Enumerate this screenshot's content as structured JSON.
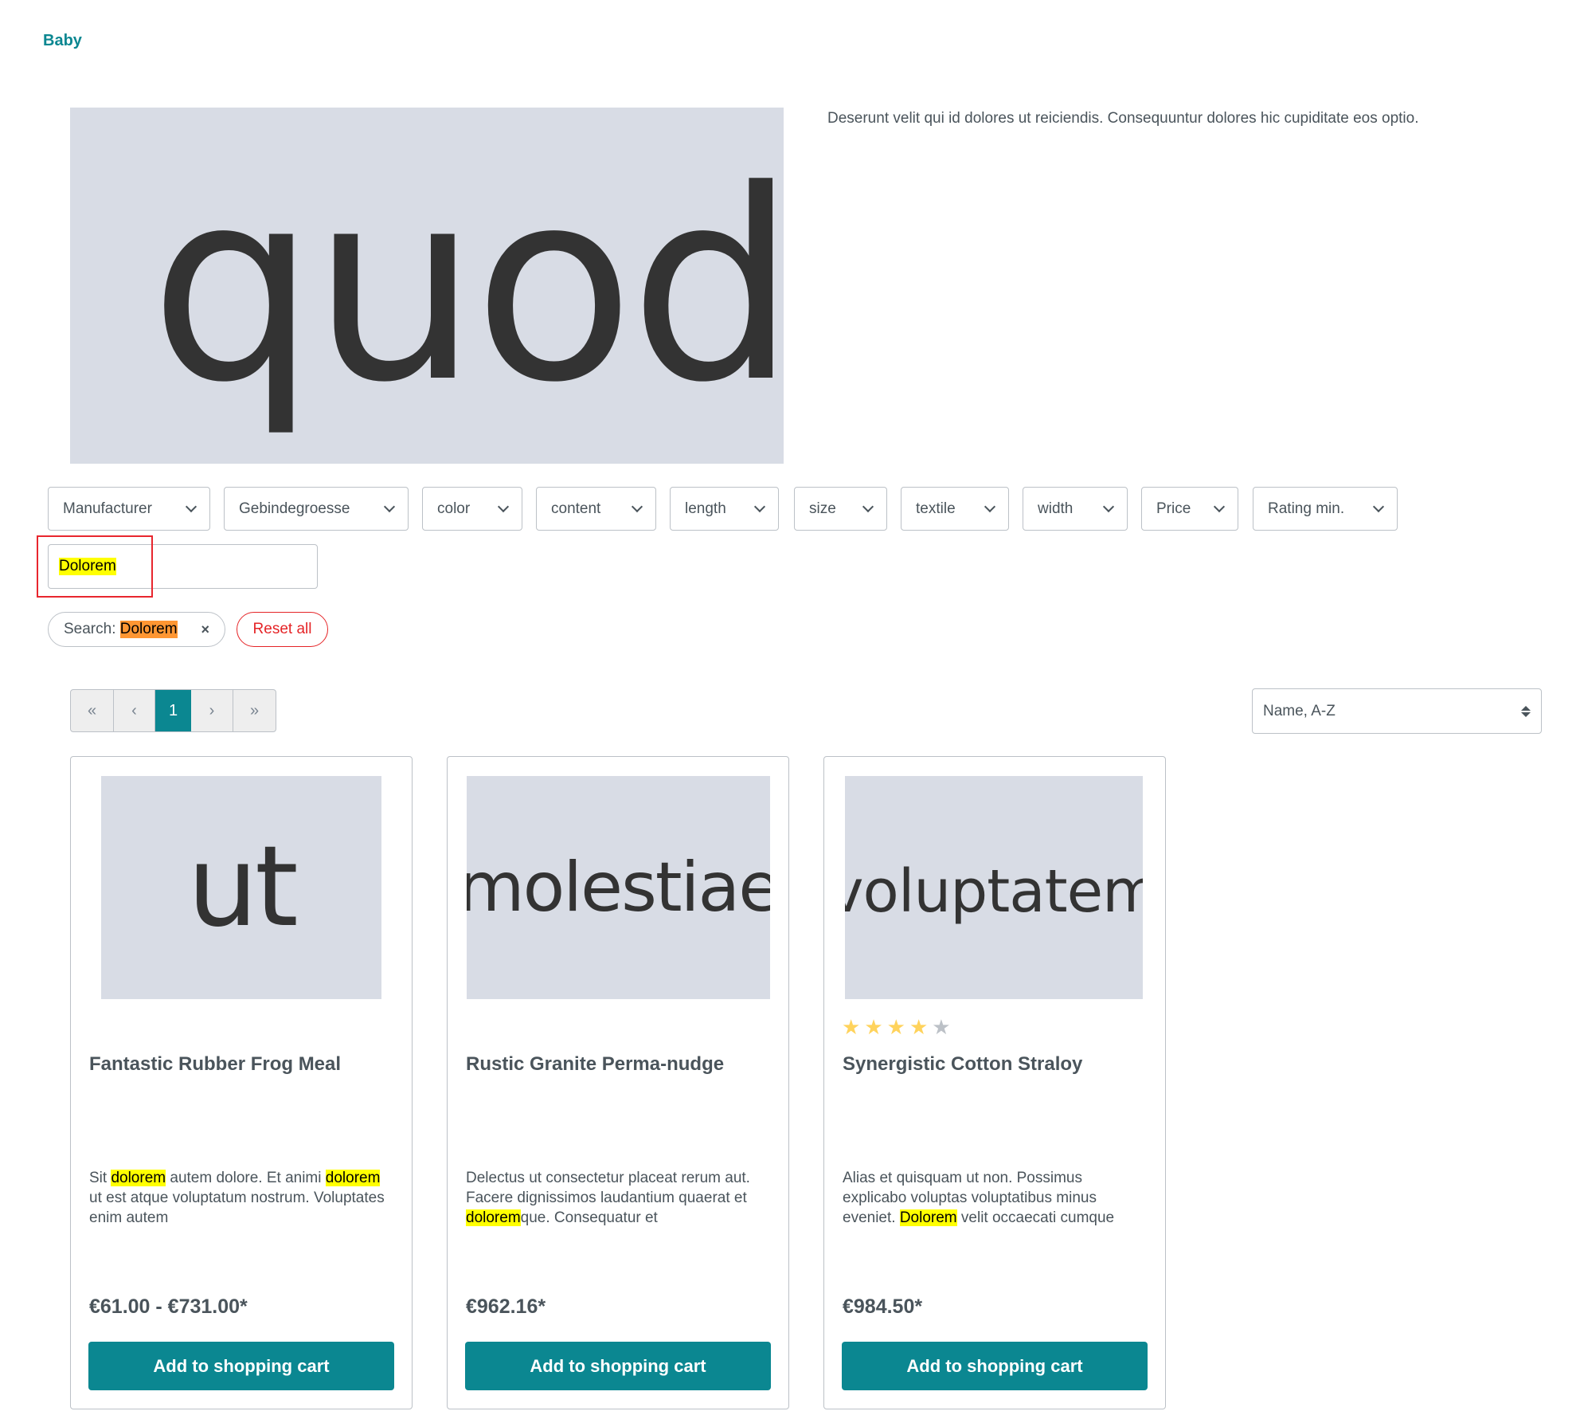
{
  "category": {
    "title": "Baby"
  },
  "hero": {
    "image_text": "quod",
    "description": "Deserunt velit qui id dolores ut reiciendis. Consequuntur dolores hic cupiditate eos optio."
  },
  "filters": [
    {
      "label": "Manufacturer"
    },
    {
      "label": "Gebindegroesse"
    },
    {
      "label": "color"
    },
    {
      "label": "content"
    },
    {
      "label": "length"
    },
    {
      "label": "size"
    },
    {
      "label": "textile"
    },
    {
      "label": "width"
    },
    {
      "label": "Price"
    },
    {
      "label": "Rating min."
    }
  ],
  "search": {
    "value": "Dolorem"
  },
  "active_filters": {
    "search_prefix": "Search: ",
    "search_term": "Dolorem",
    "remove_icon": "×",
    "reset_label": "Reset all"
  },
  "pagination": {
    "first": "«",
    "prev": "‹",
    "current": "1",
    "next": "›",
    "last": "»"
  },
  "sort": {
    "selected": "Name, A-Z"
  },
  "colors": {
    "accent": "#0b8791",
    "highlight": "#ffff00",
    "active_highlight": "#ff9632",
    "danger": "#e52427",
    "star_filled": "#ffd35c",
    "star_empty": "#bcc1c7"
  },
  "products": [
    {
      "image_text": "ut",
      "name": "Fantastic Rubber Frog Meal",
      "rating": null,
      "description_parts": [
        {
          "t": "Sit ",
          "h": false
        },
        {
          "t": "dolorem",
          "h": true
        },
        {
          "t": " autem dolore. Et animi ",
          "h": false
        },
        {
          "t": "dolorem",
          "h": true
        },
        {
          "t": " ut est atque voluptatum nostrum. Voluptates enim autem",
          "h": false
        }
      ],
      "price": "€61.00 - €731.00*",
      "button": "Add to shopping cart"
    },
    {
      "image_text": "molestiae",
      "name": "Rustic Granite Perma-nudge",
      "rating": null,
      "description_parts": [
        {
          "t": "Delectus ut consectetur placeat rerum aut. Facere dignissimos laudantium quaerat et ",
          "h": false
        },
        {
          "t": "dolorem",
          "h": true
        },
        {
          "t": "que. Consequatur et",
          "h": false
        }
      ],
      "price": "€962.16*",
      "button": "Add to shopping cart"
    },
    {
      "image_text": "voluptatem",
      "name": "Synergistic Cotton Straloy",
      "rating": {
        "value": 4,
        "max": 5
      },
      "description_parts": [
        {
          "t": "Alias et quisquam ut non. Possimus explicabo voluptas voluptatibus minus eveniet. ",
          "h": false
        },
        {
          "t": "Dolorem",
          "h": true
        },
        {
          "t": " velit occaecati cumque",
          "h": false
        }
      ],
      "price": "€984.50*",
      "button": "Add to shopping cart"
    }
  ]
}
